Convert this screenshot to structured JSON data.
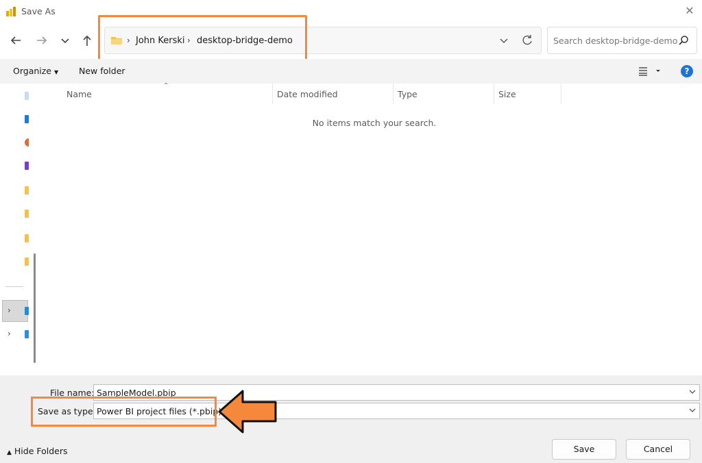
{
  "window": {
    "title": "Save As"
  },
  "address": {
    "crumbs": [
      "John Kerski",
      "desktop-bridge-demo"
    ]
  },
  "search": {
    "placeholder": "Search desktop-bridge-demo"
  },
  "toolbar": {
    "organize_label": "Organize",
    "new_folder_label": "New folder"
  },
  "columns": [
    "Name",
    "Date modified",
    "Type",
    "Size"
  ],
  "list": {
    "empty_message": "No items match your search."
  },
  "form": {
    "file_name_label": "File name:",
    "file_name_value": "SampleModel.pbip",
    "save_type_label": "Save as type:",
    "save_type_value": "Power BI project files (*.pbip)"
  },
  "footer": {
    "hide_folders_label": "Hide Folders",
    "save_label": "Save",
    "cancel_label": "Cancel"
  },
  "colors": {
    "highlight": "#f5883a",
    "help": "#1e73d6",
    "folder": "#f2c14e"
  },
  "icons": [
    "power-bi-app-icon",
    "close-icon",
    "back-arrow-icon",
    "forward-arrow-icon",
    "recent-chevron-icon",
    "up-arrow-icon",
    "folder-icon",
    "refresh-icon",
    "search-icon",
    "view-options-icon",
    "help-icon"
  ]
}
